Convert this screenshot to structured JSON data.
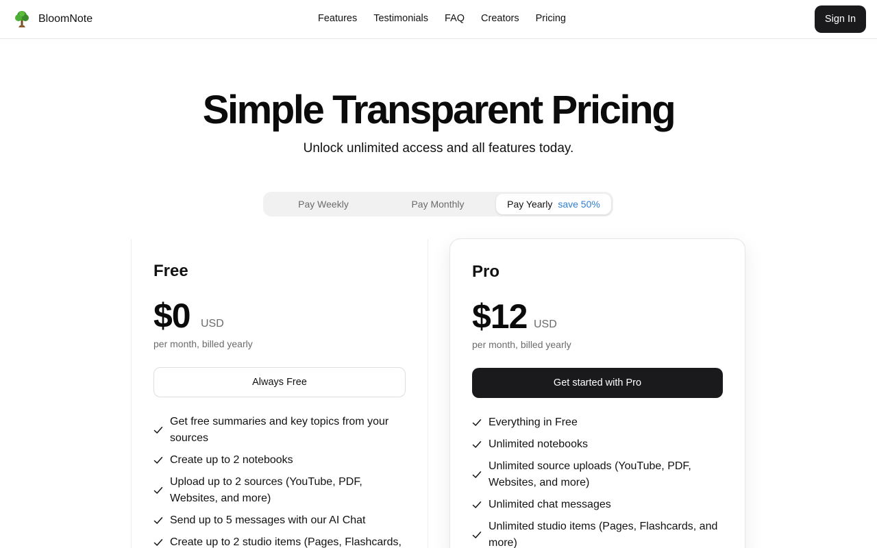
{
  "header": {
    "brand": "BloomNote",
    "logo_icon": "tree-icon",
    "nav": [
      "Features",
      "Testimonials",
      "FAQ",
      "Creators",
      "Pricing"
    ],
    "signin_label": "Sign In"
  },
  "hero": {
    "title": "Simple Transparent Pricing",
    "subtitle": "Unlock unlimited access and all features today."
  },
  "billing_toggle": {
    "options": [
      "Pay Weekly",
      "Pay Monthly",
      "Pay Yearly"
    ],
    "selected": "Pay Yearly",
    "save_badge": "save 50%",
    "save_color": "#2f7fd1"
  },
  "plans": [
    {
      "name": "Free",
      "price": "$0",
      "currency": "USD",
      "billing": "per month, billed yearly",
      "cta": "Always Free",
      "features": [
        "Get free summaries and key topics from your sources",
        "Create up to 2 notebooks",
        "Upload up to 2 sources (YouTube, PDF, Websites, and more)",
        "Send up to 5 messages with our AI Chat",
        "Create up to 2 studio items (Pages, Flashcards,"
      ]
    },
    {
      "name": "Pro",
      "price": "$12",
      "currency": "USD",
      "billing": "per month, billed yearly",
      "cta": "Get started with Pro",
      "features": [
        "Everything in Free",
        "Unlimited notebooks",
        "Unlimited source uploads (YouTube, PDF, Websites, and more)",
        "Unlimited chat messages",
        "Unlimited studio items (Pages, Flashcards, and more)"
      ]
    }
  ],
  "colors": {
    "primary_button": "#1a1a1c",
    "text": "#111111",
    "muted": "#6b6b6b"
  }
}
